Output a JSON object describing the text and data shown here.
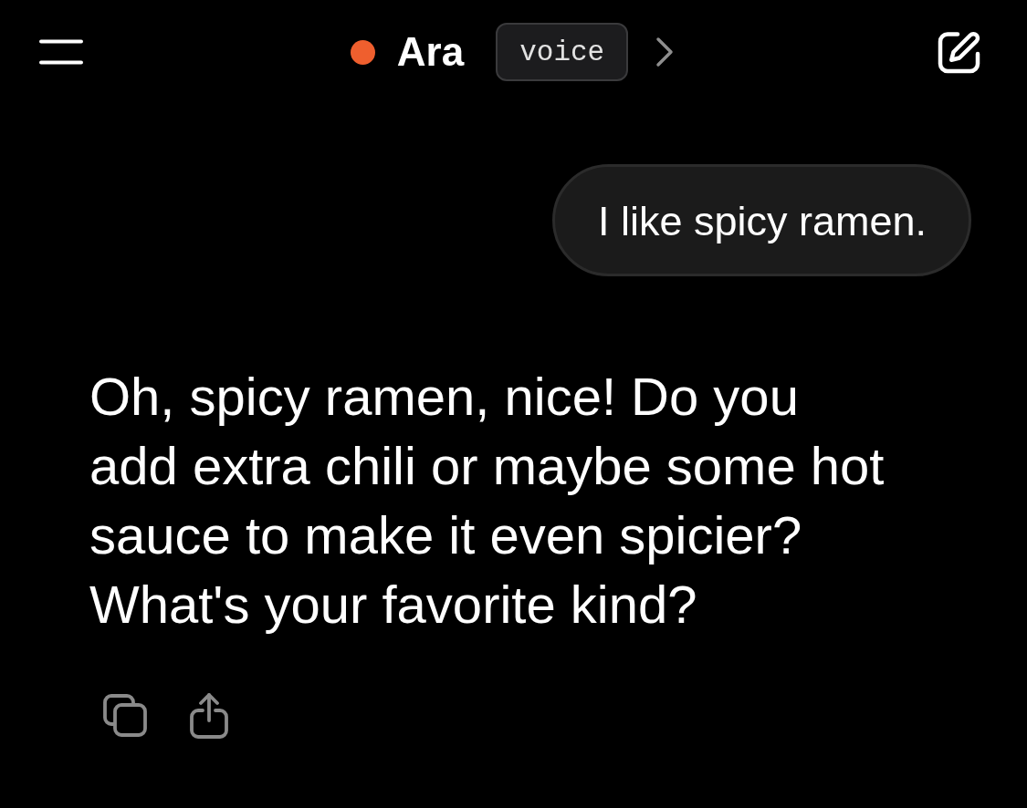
{
  "header": {
    "assistant_name": "Ara",
    "mode_badge": "voice"
  },
  "messages": [
    {
      "kind": "user",
      "lines": [
        "I like spicy ramen."
      ]
    },
    {
      "kind": "assistant",
      "lines": [
        "Oh, spicy ramen, nice! Do you",
        "add extra chili or maybe some hot",
        "sauce to make it even spicier?",
        "What's your favorite kind?"
      ]
    }
  ]
}
